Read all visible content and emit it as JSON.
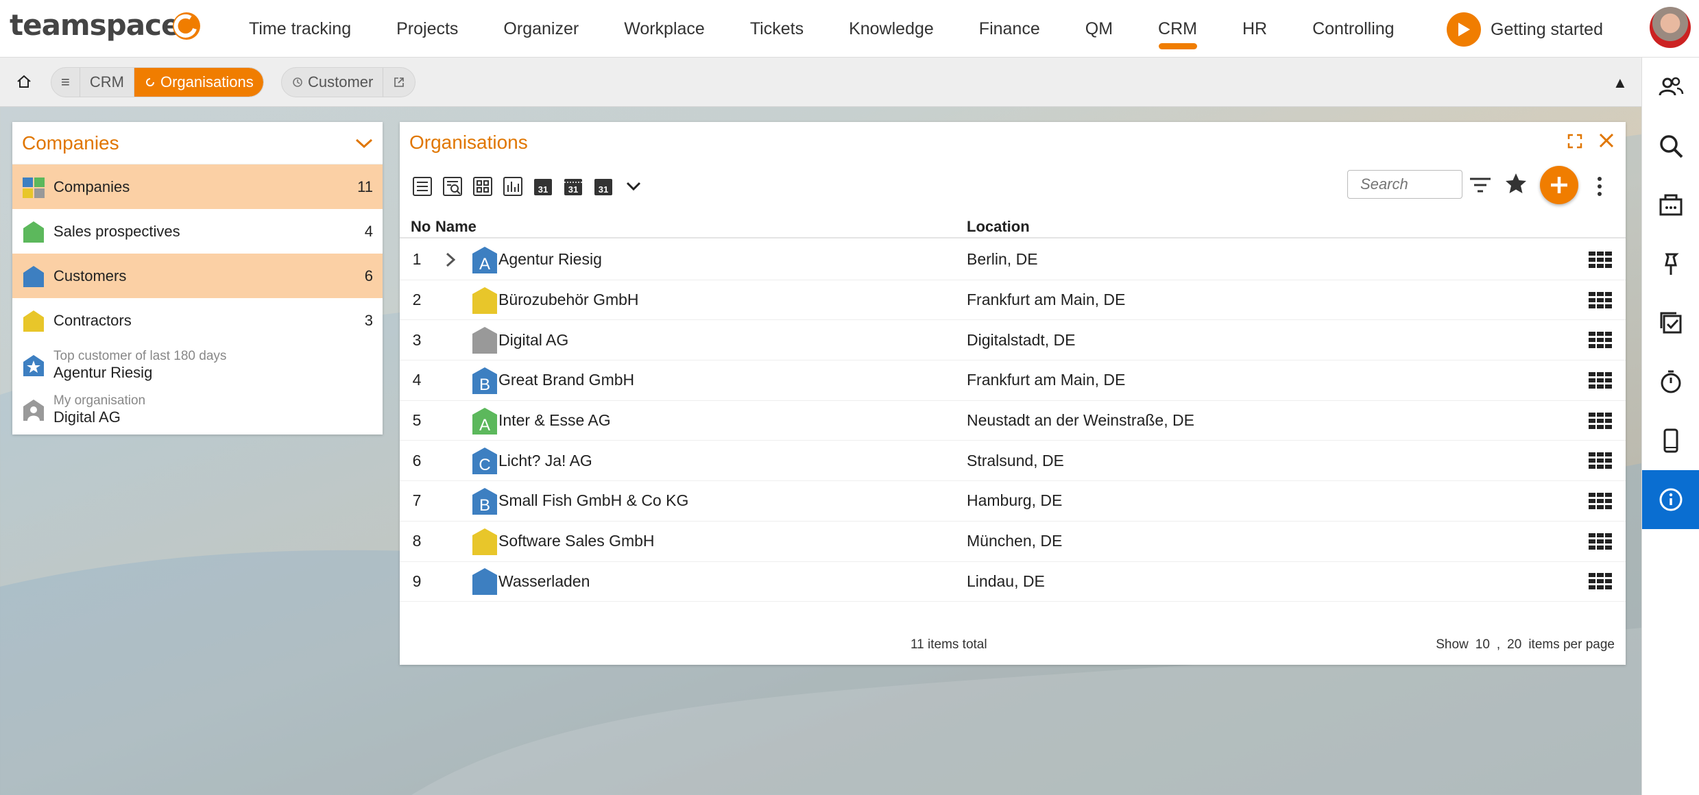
{
  "app": {
    "logo_text": "teamspace"
  },
  "nav": {
    "items": [
      {
        "label": "Time tracking"
      },
      {
        "label": "Projects"
      },
      {
        "label": "Organizer"
      },
      {
        "label": "Workplace"
      },
      {
        "label": "Tickets"
      },
      {
        "label": "Knowledge"
      },
      {
        "label": "Finance"
      },
      {
        "label": "QM"
      },
      {
        "label": "CRM",
        "active": true
      },
      {
        "label": "HR"
      },
      {
        "label": "Controlling"
      }
    ],
    "getting_started": "Getting started"
  },
  "breadcrumb": {
    "menu": "≡",
    "crm": "CRM",
    "active": "Organisations",
    "customer": "Customer"
  },
  "left_panel": {
    "title": "Companies",
    "items": [
      {
        "label": "Companies",
        "count": "11",
        "selected": true
      },
      {
        "label": "Sales prospectives",
        "count": "4"
      },
      {
        "label": "Customers",
        "count": "6",
        "selected": true
      },
      {
        "label": "Contractors",
        "count": "3"
      }
    ],
    "top_customer": {
      "caption": "Top customer of last 180 days",
      "name": "Agentur Riesig"
    },
    "my_org": {
      "caption": "My organisation",
      "name": "Digital AG"
    }
  },
  "main": {
    "title": "Organisations",
    "search_placeholder": "Search",
    "columns": {
      "no": "No",
      "name": "Name",
      "location": "Location"
    },
    "calendar_day": "31",
    "rows": [
      {
        "no": "1",
        "name": "Agentur Riesig",
        "location": "Berlin, DE",
        "badge": "A",
        "color": "#3d7fc1",
        "expandable": true
      },
      {
        "no": "2",
        "name": "Bürozubehör GmbH",
        "location": "Frankfurt am Main, DE",
        "badge": "",
        "color": "#e8c62a"
      },
      {
        "no": "3",
        "name": "Digital AG",
        "location": "Digitalstadt, DE",
        "badge": "",
        "color": "#999999"
      },
      {
        "no": "4",
        "name": "Great Brand GmbH",
        "location": "Frankfurt am Main, DE",
        "badge": "B",
        "color": "#3d7fc1"
      },
      {
        "no": "5",
        "name": "Inter & Esse AG",
        "location": "Neustadt an der Weinstraße, DE",
        "badge": "A",
        "color": "#5cb85c"
      },
      {
        "no": "6",
        "name": "Licht? Ja! AG",
        "location": "Stralsund, DE",
        "badge": "C",
        "color": "#3d7fc1"
      },
      {
        "no": "7",
        "name": "Small Fish GmbH & Co KG",
        "location": "Hamburg, DE",
        "badge": "B",
        "color": "#3d7fc1"
      },
      {
        "no": "8",
        "name": "Software Sales GmbH",
        "location": "München, DE",
        "badge": "",
        "color": "#e8c62a"
      },
      {
        "no": "9",
        "name": "Wasserladen",
        "location": "Lindau, DE",
        "badge": "",
        "color": "#3d7fc1"
      }
    ],
    "footer": {
      "total": "11 items total",
      "show": "Show",
      "opt1": "10",
      "sep": ",",
      "opt2": "20",
      "per_page": "items per page"
    }
  },
  "colors": {
    "accent": "#f07d00",
    "rail_active": "#0a6ed1"
  }
}
